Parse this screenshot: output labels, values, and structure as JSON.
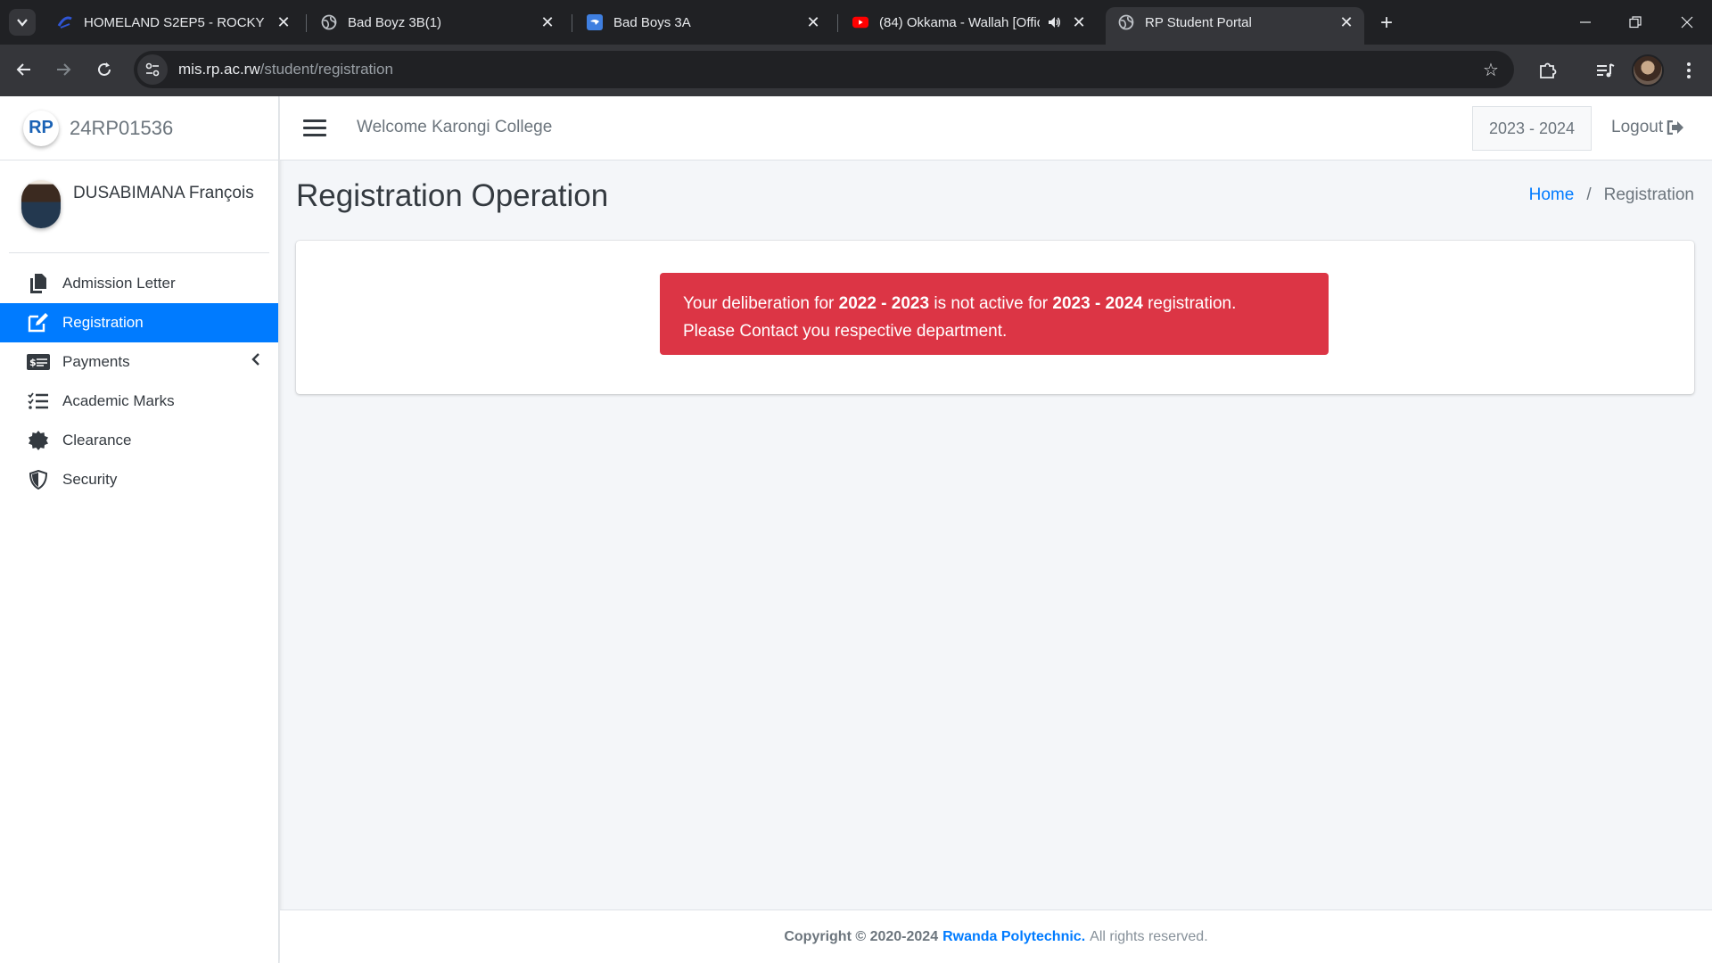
{
  "browser": {
    "tabs": [
      {
        "title": "HOMELAND S2EP5 - ROCKY",
        "icon": "starz-icon",
        "active": false
      },
      {
        "title": "Bad Boyz 3B(1)",
        "icon": "globe-icon",
        "active": false
      },
      {
        "title": "Bad Boys 3A",
        "icon": "app-icon",
        "active": false
      },
      {
        "title": "(84) Okkama - Wallah [Offic",
        "icon": "youtube-icon",
        "active": false,
        "audio": true
      },
      {
        "title": "RP Student Portal",
        "icon": "globe-icon",
        "active": true
      }
    ],
    "url_host": "mis.rp.ac.rw",
    "url_path": "/student/registration"
  },
  "sidebar": {
    "brand_text": "24RP01536",
    "brand_logo_text": "RP",
    "user_name": "DUSABIMANA François",
    "items": [
      {
        "label": "Admission Letter",
        "icon": "file-copy-icon",
        "active": false
      },
      {
        "label": "Registration",
        "icon": "edit-icon",
        "active": true
      },
      {
        "label": "Payments",
        "icon": "money-icon",
        "active": false,
        "has_submenu": true
      },
      {
        "label": "Academic Marks",
        "icon": "list-check-icon",
        "active": false
      },
      {
        "label": "Clearance",
        "icon": "certificate-icon",
        "active": false
      },
      {
        "label": "Security",
        "icon": "shield-icon",
        "active": false
      }
    ]
  },
  "topnav": {
    "welcome": "Welcome Karongi College",
    "academic_year": "2023 - 2024",
    "logout_label": "Logout"
  },
  "main": {
    "title": "Registration Operation",
    "breadcrumb": {
      "home": "Home",
      "separator": "/",
      "current": "Registration"
    },
    "alert": {
      "part1": "Your deliberation for ",
      "year1": "2022 - 2023",
      "part2": " is not active for ",
      "year2": "2023 - 2024",
      "part3": " registration.",
      "line2": "Please Contact you respective department.",
      "color": "#dc3545"
    }
  },
  "footer": {
    "copyright": "Copyright © 2020-2024",
    "org": "Rwanda Polytechnic.",
    "rest": "All rights reserved."
  },
  "colors": {
    "accent": "#007bff",
    "danger": "#dc3545"
  }
}
